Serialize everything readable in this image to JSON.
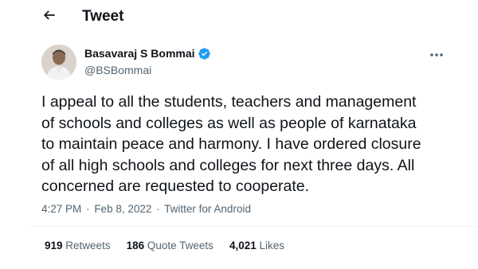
{
  "header": {
    "title": "Tweet",
    "back_icon": "arrow-left-icon"
  },
  "author": {
    "display_name": "Basavaraj S Bommai",
    "handle": "@BSBommai",
    "verified_icon": "verified-badge-icon",
    "verified_color": "#1d9bf0"
  },
  "more_icon": "more-horizontal-icon",
  "tweet": {
    "lines": [
      "I appeal to all the students,  teachers and management",
      "of schools and colleges as well as people of karnataka",
      "to maintain peace and harmony. I have ordered closure",
      "of all high schools and colleges for next three days. All",
      "concerned are requested to cooperate."
    ]
  },
  "meta": {
    "time": "4:27 PM",
    "separator": "·",
    "date": "Feb 8, 2022",
    "source": "Twitter for Android"
  },
  "stats": {
    "retweets_count": "919",
    "retweets_label": "Retweets",
    "quote_count": "186",
    "quote_label": "Quote Tweets",
    "likes_count": "4,021",
    "likes_label": "Likes"
  }
}
